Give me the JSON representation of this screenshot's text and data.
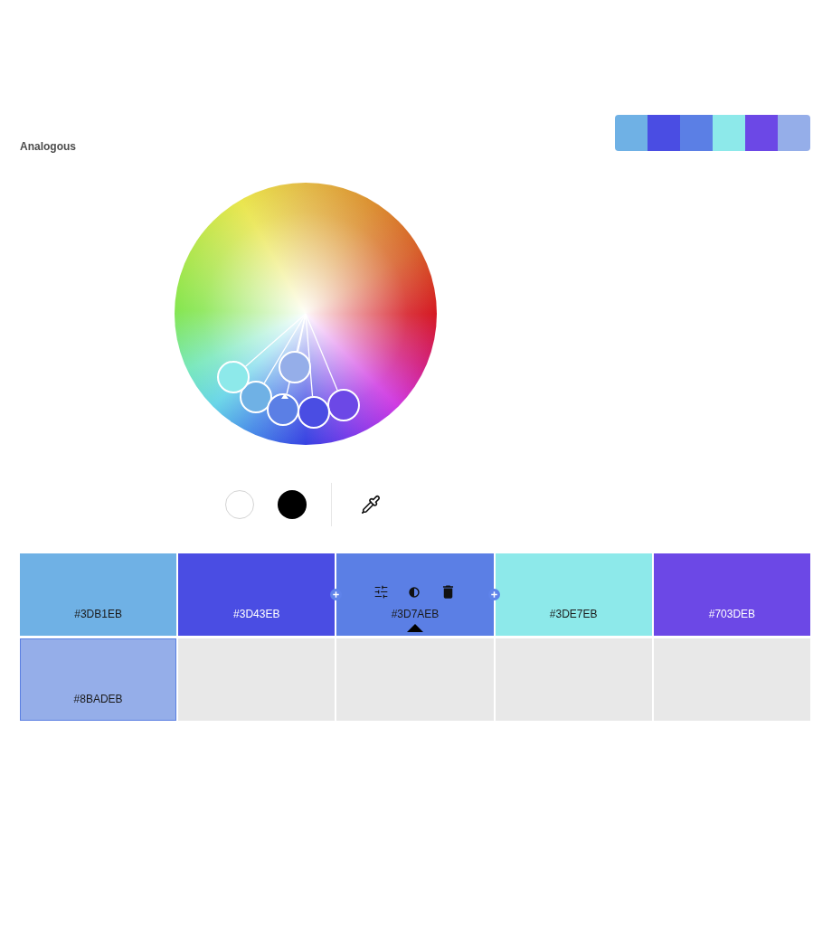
{
  "harmony": {
    "title": "Analogous"
  },
  "swatches": [
    {
      "hex": "#3DB1EB",
      "color": "#6fb1e5",
      "selected": false,
      "highlighted": false
    },
    {
      "hex": "#3D43EB",
      "color": "#4a4de3",
      "selected": false,
      "highlighted": false
    },
    {
      "hex": "#3D7AEB",
      "color": "#5b7fe5",
      "selected": true,
      "highlighted": false
    },
    {
      "hex": "#3DE7EB",
      "color": "#8de9ea",
      "selected": false,
      "highlighted": false
    },
    {
      "hex": "#703DEB",
      "color": "#6c48e6",
      "selected": false,
      "highlighted": false
    },
    {
      "hex": "#8BADEB",
      "color": "#95aee9",
      "selected": false,
      "highlighted": true
    }
  ]
}
